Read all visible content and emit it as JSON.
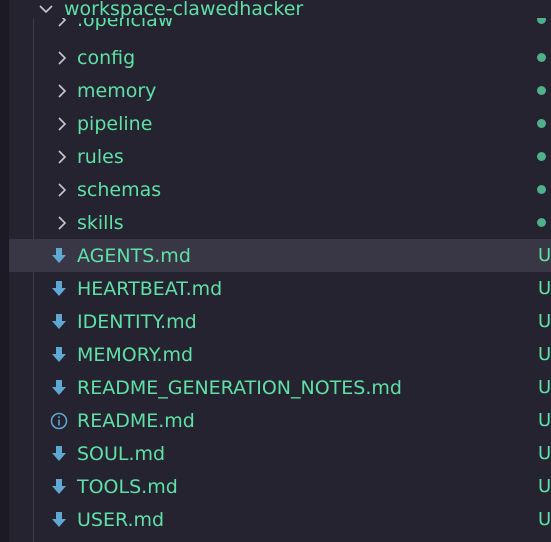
{
  "explorer": {
    "root_folder": "workspace-clawedhacker",
    "partial_folder": ".openclaw",
    "folders": [
      {
        "label": "config"
      },
      {
        "label": "memory"
      },
      {
        "label": "pipeline"
      },
      {
        "label": "rules"
      },
      {
        "label": "schemas"
      },
      {
        "label": "skills"
      }
    ],
    "files": [
      {
        "label": "AGENTS.md",
        "status": "U",
        "icon": "download-arrow-icon"
      },
      {
        "label": "HEARTBEAT.md",
        "status": "U",
        "icon": "download-arrow-icon"
      },
      {
        "label": "IDENTITY.md",
        "status": "U",
        "icon": "download-arrow-icon"
      },
      {
        "label": "MEMORY.md",
        "status": "U",
        "icon": "download-arrow-icon"
      },
      {
        "label": "README_GENERATION_NOTES.md",
        "status": "U",
        "icon": "download-arrow-icon"
      },
      {
        "label": "README.md",
        "status": "U",
        "icon": "info-icon"
      },
      {
        "label": "SOUL.md",
        "status": "U",
        "icon": "download-arrow-icon"
      },
      {
        "label": "TOOLS.md",
        "status": "U",
        "icon": "download-arrow-icon"
      },
      {
        "label": "USER.md",
        "status": "U",
        "icon": "download-arrow-icon"
      }
    ],
    "selected_file": "AGENTS.md"
  },
  "colors": {
    "background": "#25232f",
    "selected_row": "#393745",
    "text_untracked": "#5ee0a6",
    "dot": "#4fb08a",
    "icon_blue": "#5fa8d3"
  }
}
